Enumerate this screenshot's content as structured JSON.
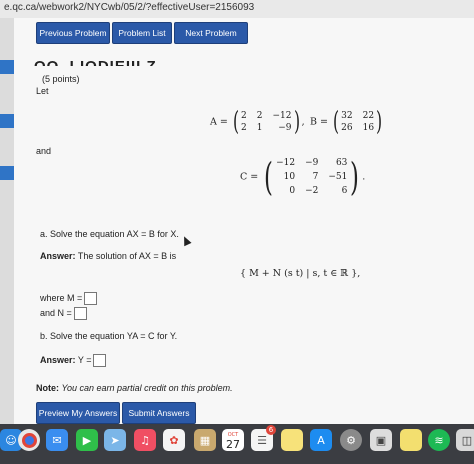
{
  "browser": {
    "url": "e.qc.ca/webwork2/NYCwb/05/2/?effectiveUser=2156093"
  },
  "nav": {
    "previous": "Previous Problem",
    "list": "Problem List",
    "next": "Next Problem"
  },
  "problem": {
    "title_cut": "OO. I IODIEIII Z",
    "points": "(5 points)",
    "let": "Let",
    "and": "and",
    "A_label": "A =",
    "A": [
      [
        "2",
        "2",
        "−12"
      ],
      [
        "2",
        "1",
        "−9"
      ]
    ],
    "B_label": "B =",
    "B": [
      [
        "32",
        "22"
      ],
      [
        "26",
        "16"
      ]
    ],
    "C_label": "C =",
    "C": [
      [
        "−12",
        "−9",
        "63"
      ],
      [
        "10",
        "7",
        "−51"
      ],
      [
        "0",
        "−2",
        "6"
      ]
    ],
    "part_a": "a. Solve the equation AX = B for X.",
    "answer_a_prefix": "Answer:",
    "answer_a_text": "The solution of AX = B is",
    "solution_set": "{ M + N (s   t) | s, t ∈ ℝ },",
    "where_m": "where M =",
    "and_n": "and N =",
    "part_b": "b. Solve the equation YA = C for Y.",
    "answer_b_prefix": "Answer:",
    "answer_b_text": "Y =",
    "note_label": "Note:",
    "note_text": "You can earn partial credit on this problem."
  },
  "submit": {
    "preview": "Preview My Answers",
    "submit": "Submit Answers"
  },
  "dock": {
    "calendar_month": "OCT",
    "calendar_day": "27",
    "badge": "6",
    "icons": [
      "finder-icon",
      "chrome-icon",
      "mail-icon",
      "facetime-icon",
      "maps-icon",
      "music-icon",
      "photos-icon",
      "notes-icon",
      "calendar-icon",
      "reminders-icon",
      "stickies-icon",
      "appstore-icon",
      "system-preferences-icon",
      "preview-icon",
      "notes-yellow-icon",
      "spotify-icon",
      "screenshot-icon"
    ]
  },
  "colors": {
    "button": "#2b59a8",
    "accent": "#2f74c6",
    "dock": "#3b3d42"
  }
}
